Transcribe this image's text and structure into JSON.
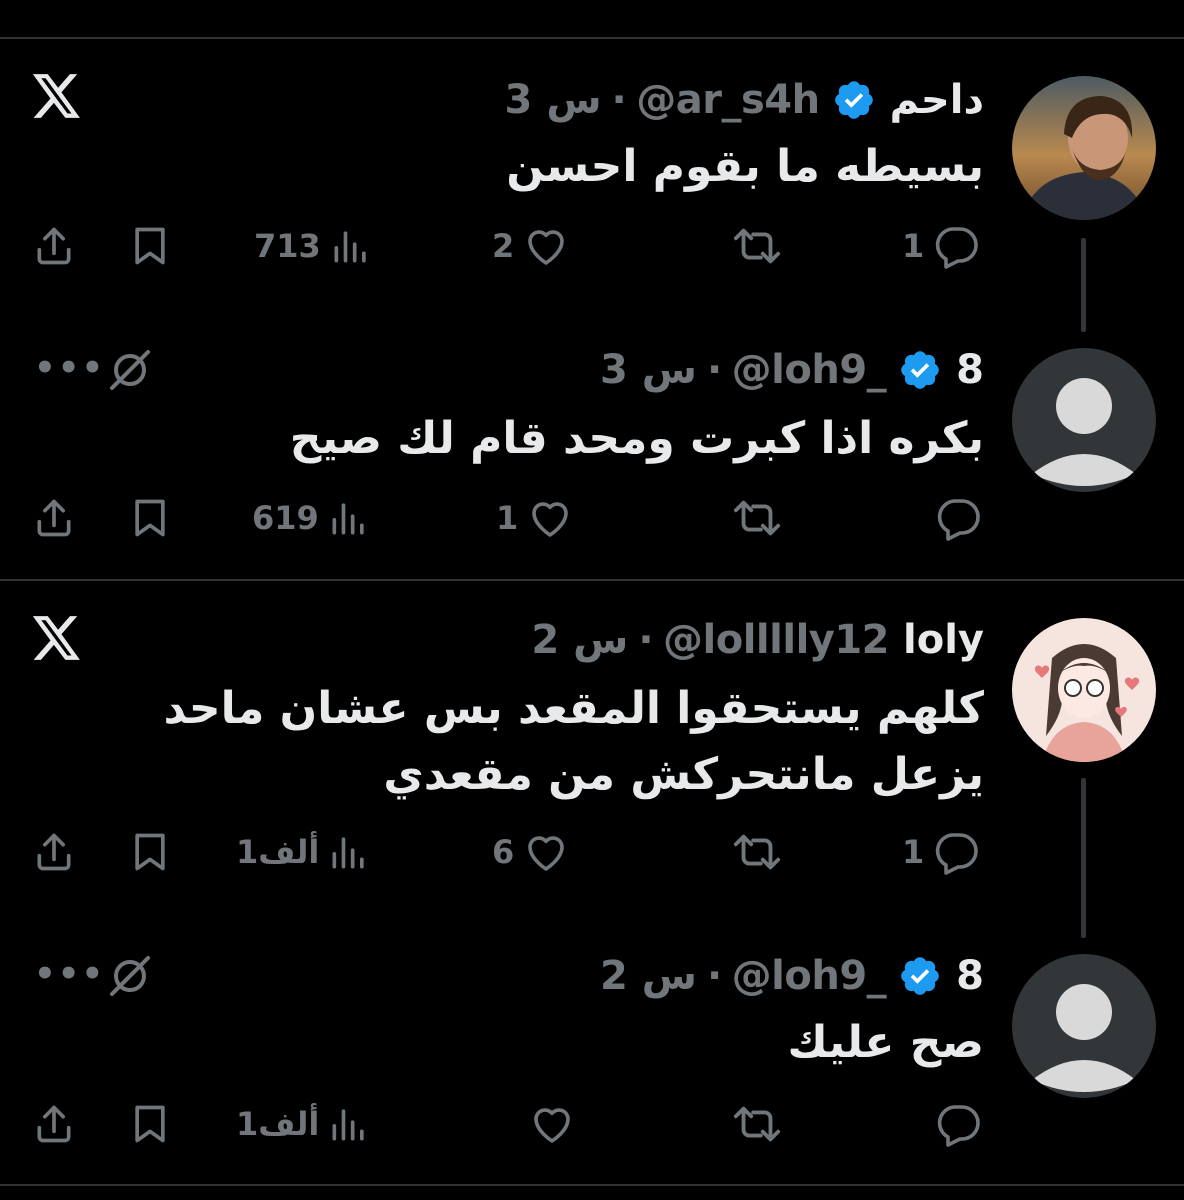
{
  "tweets": [
    {
      "name": "داحم",
      "handle": "@ar_s4h",
      "time": "3 س",
      "separator": "·",
      "verified": true,
      "text": "بسيطه ما بقوم احسن",
      "reply_count": "1",
      "retweet_count": "",
      "like_count": "2",
      "view_count": "713",
      "avatar": "photo-avatar-man",
      "corner": "x-logo-icon"
    },
    {
      "name": "8",
      "handle": "@loh9_",
      "time": "3 س",
      "separator": "·",
      "verified": true,
      "text": "بكره اذا كبرت ومحد قام لك صيح",
      "reply_count": "",
      "retweet_count": "",
      "like_count": "1",
      "view_count": "619",
      "avatar": "default-avatar",
      "corner": "more-grok"
    },
    {
      "name": "loly",
      "handle": "@lollllly12",
      "time": "2 س",
      "separator": "·",
      "verified": false,
      "text_lines": [
        "كلهم يستحقوا المقعد بس عشان ماحد",
        "يزعل مانتحركش من مقعدي"
      ],
      "reply_count": "1",
      "retweet_count": "",
      "like_count": "6",
      "view_count": "1ألف",
      "avatar": "illustrated-girl-avatar",
      "corner": "x-logo-icon"
    },
    {
      "name": "8",
      "handle": "@loh9_",
      "time": "2 س",
      "separator": "·",
      "verified": true,
      "text": "صح عليك",
      "reply_count": "",
      "retweet_count": "",
      "like_count": "",
      "view_count": "1ألف",
      "avatar": "default-avatar",
      "corner": "more-grok"
    }
  ],
  "more_label": "•••",
  "colors": {
    "background": "#000000",
    "text": "#e7e9ea",
    "muted": "#71767b",
    "verified": "#1d9bf0",
    "separator": "#2f3336"
  }
}
